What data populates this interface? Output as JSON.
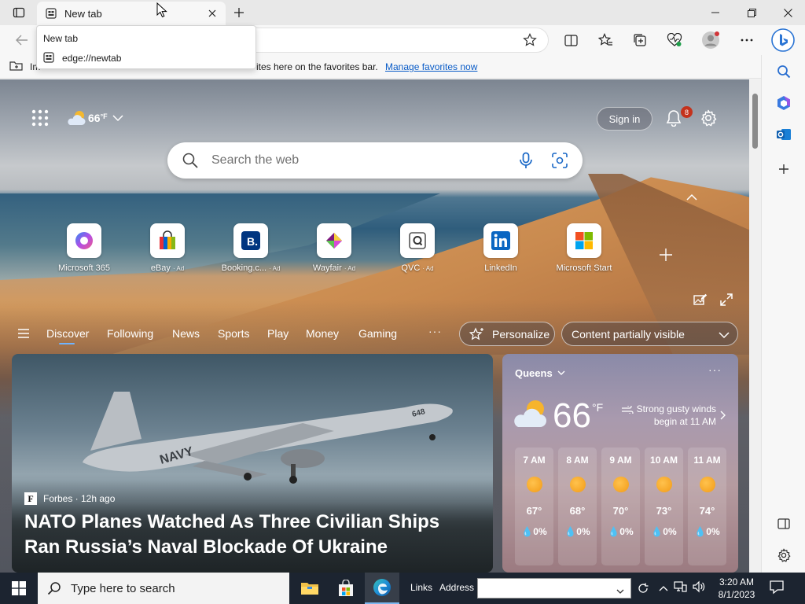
{
  "tab": {
    "title": "New tab"
  },
  "tooltip": {
    "title": "New tab",
    "url": "edge://newtab"
  },
  "favorites_bar": {
    "truncated_start": "Im",
    "hint_text": "ites here on the favorites bar.",
    "manage_link": "Manage favorites now"
  },
  "hero": {
    "weather_temp": "66",
    "weather_unit": "°F",
    "signin_label": "Sign in",
    "notification_count": "8",
    "search_placeholder": "Search the web"
  },
  "quick_links": [
    {
      "label": "Microsoft 365",
      "ad": ""
    },
    {
      "label": "eBay",
      "ad": "· Ad"
    },
    {
      "label": "Booking.c...",
      "ad": "· Ad"
    },
    {
      "label": "Wayfair",
      "ad": "· Ad"
    },
    {
      "label": "QVC",
      "ad": "· Ad"
    },
    {
      "label": "LinkedIn",
      "ad": ""
    },
    {
      "label": "Microsoft Start",
      "ad": ""
    }
  ],
  "feed": {
    "tabs": [
      "Discover",
      "Following",
      "News",
      "Sports",
      "Play",
      "Money",
      "Gaming"
    ],
    "more": "···",
    "personalize": "Personalize",
    "content_visibility": "Content partially visible"
  },
  "news": {
    "source_logo": "F",
    "source": "Forbes · 12h ago",
    "headline": "NATO Planes Watched As Three Civilian Ships Ran Russia’s Naval Blockade Of Ukraine"
  },
  "weather_card": {
    "city": "Queens",
    "more": "···",
    "temp": "66",
    "unit": "°F",
    "alert": "Strong gusty winds begin at 11 AM",
    "hours": [
      {
        "time": "7 AM",
        "temp": "67°",
        "precip": "0%"
      },
      {
        "time": "8 AM",
        "temp": "68°",
        "precip": "0%"
      },
      {
        "time": "9 AM",
        "temp": "70°",
        "precip": "0%"
      },
      {
        "time": "10 AM",
        "temp": "73°",
        "precip": "0%"
      },
      {
        "time": "11 AM",
        "temp": "74°",
        "precip": "0%"
      }
    ]
  },
  "taskbar": {
    "search_placeholder": "Type here to search",
    "links_label": "Links",
    "address_label": "Address",
    "time": "3:20 AM",
    "date": "8/1/2023"
  },
  "colors": {
    "accent": "#0a5cc7",
    "badge": "#c4321c",
    "taskbar": "#1c2430"
  }
}
